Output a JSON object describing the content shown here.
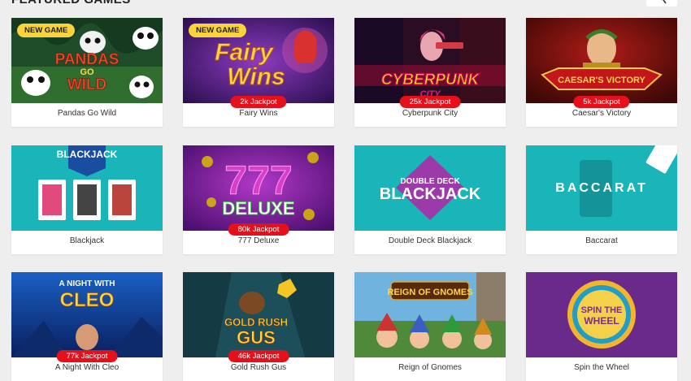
{
  "section": {
    "title": "FEATURED GAMES"
  },
  "games": [
    {
      "name": "Pandas Go Wild",
      "badge": "NEW GAME",
      "jackpot": "",
      "art": [
        "PANDAS",
        "GO",
        "WILD"
      ]
    },
    {
      "name": "Fairy Wins",
      "badge": "NEW GAME",
      "jackpot": "2k Jackpot",
      "art": [
        "Fairy",
        "Wins"
      ]
    },
    {
      "name": "Cyberpunk City",
      "badge": "",
      "jackpot": "25k Jackpot",
      "art": [
        "CYBERPUNK",
        "CITY"
      ]
    },
    {
      "name": "Caesar's Victory",
      "badge": "",
      "jackpot": "5k Jackpot",
      "art": [
        "CAESAR'S VICTORY"
      ]
    },
    {
      "name": "Blackjack",
      "badge": "",
      "jackpot": "",
      "art": [
        "BLACKJACK"
      ]
    },
    {
      "name": "777 Deluxe",
      "badge": "",
      "jackpot": "80k Jackpot",
      "art": [
        "777",
        "DELUXE"
      ]
    },
    {
      "name": "Double Deck Blackjack",
      "badge": "",
      "jackpot": "",
      "art": [
        "DOUBLE DECK",
        "BLACKJACK"
      ]
    },
    {
      "name": "Baccarat",
      "badge": "",
      "jackpot": "",
      "art": [
        "BACCARAT"
      ]
    },
    {
      "name": "A Night With Cleo",
      "badge": "",
      "jackpot": "77k Jackpot",
      "art": [
        "A NIGHT WITH",
        "CLEO"
      ]
    },
    {
      "name": "Gold Rush Gus",
      "badge": "",
      "jackpot": "46k Jackpot",
      "art": [
        "GOLD RUSH",
        "GUS"
      ]
    },
    {
      "name": "Reign of Gnomes",
      "badge": "",
      "jackpot": "",
      "art": [
        "REIGN OF GNOMES"
      ]
    },
    {
      "name": "Spin the Wheel",
      "badge": "",
      "jackpot": "",
      "art": [
        "SPIN THE",
        "WHEEL"
      ]
    }
  ]
}
